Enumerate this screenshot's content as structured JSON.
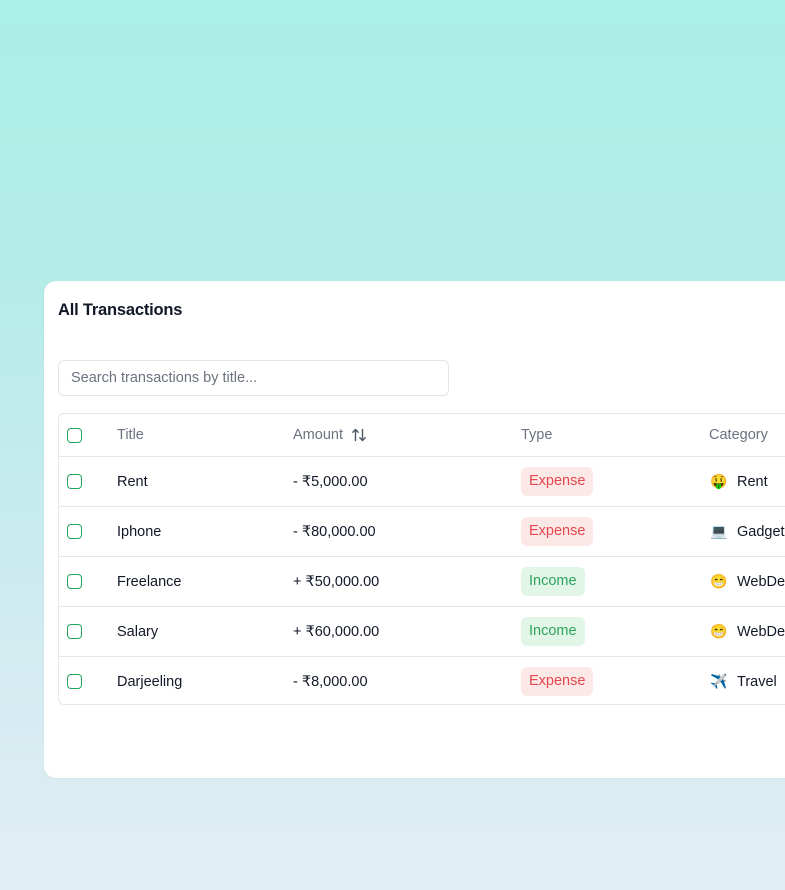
{
  "card": {
    "title": "All Transactions"
  },
  "search": {
    "placeholder": "Search transactions by title...",
    "value": ""
  },
  "table": {
    "headers": {
      "title": "Title",
      "amount": "Amount",
      "type": "Type",
      "category": "Category"
    },
    "rows": [
      {
        "title": "Rent",
        "amount": "- ₹5,000.00",
        "type": "Expense",
        "category_icon": "🤑",
        "category": "Rent"
      },
      {
        "title": "Iphone",
        "amount": "- ₹80,000.00",
        "type": "Expense",
        "category_icon": "💻",
        "category": "Gadgets"
      },
      {
        "title": "Freelance",
        "amount": "+ ₹50,000.00",
        "type": "Income",
        "category_icon": "😁",
        "category": "WebDev"
      },
      {
        "title": "Salary",
        "amount": "+ ₹60,000.00",
        "type": "Income",
        "category_icon": "😁",
        "category": "WebDev"
      },
      {
        "title": "Darjeeling",
        "amount": "- ₹8,000.00",
        "type": "Expense",
        "category_icon": "✈️",
        "category": "Travel"
      }
    ]
  },
  "colors": {
    "expense_text": "#e5484d",
    "expense_bg": "#fde8e8",
    "income_text": "#2fa35c",
    "income_bg": "#e2f6e8",
    "checkbox_border": "#22a55b"
  }
}
